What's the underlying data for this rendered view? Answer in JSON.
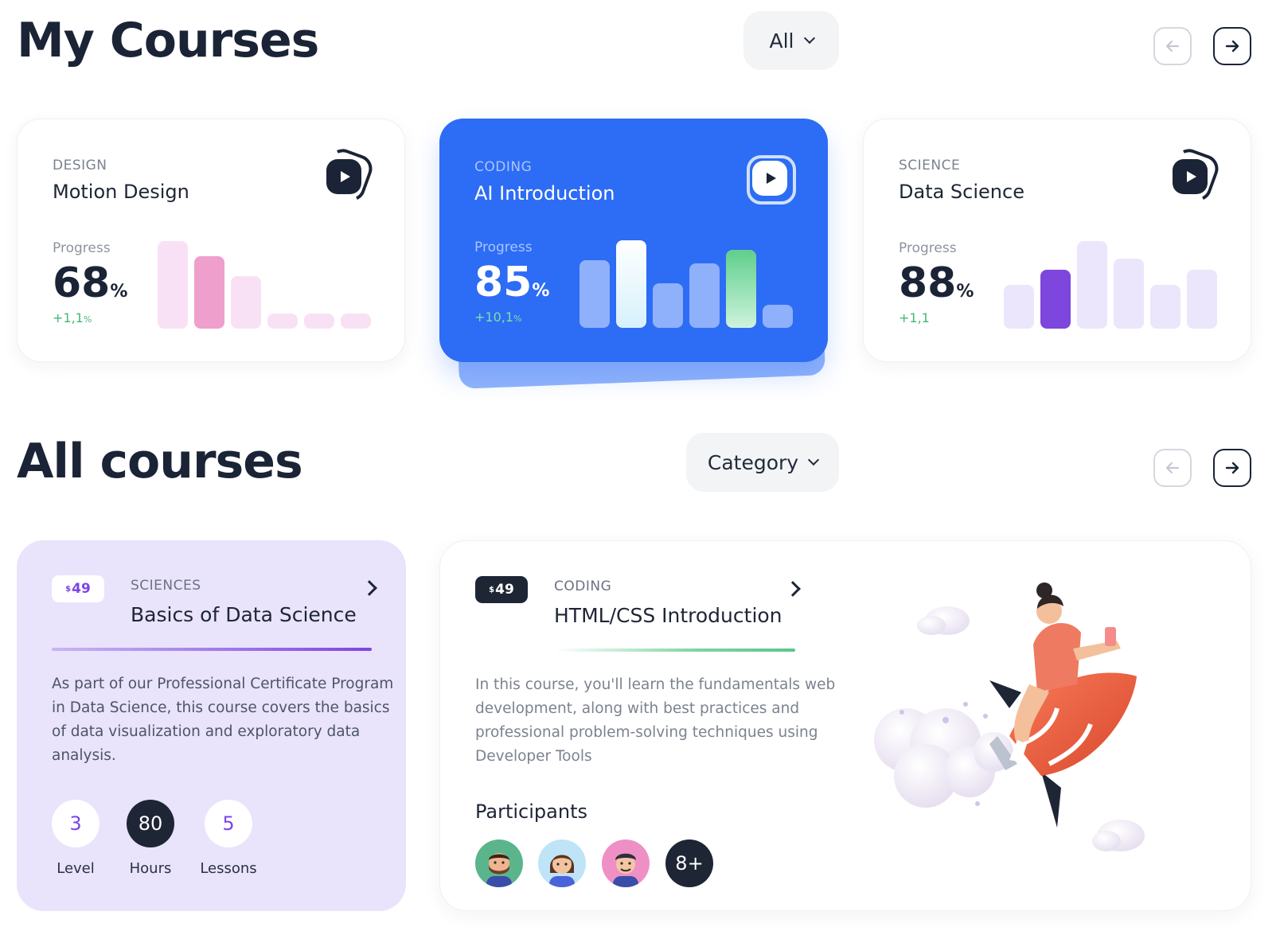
{
  "my_courses": {
    "title": "My Courses",
    "filter_label": "All",
    "cards": [
      {
        "category": "DESIGN",
        "title": "Motion Design",
        "progress_label": "Progress",
        "progress_value": "68",
        "percent_sign": "%",
        "delta": "+1,1",
        "delta_unit": "%",
        "bars": [
          {
            "height": 1.0,
            "color": "#f9e1f5"
          },
          {
            "height": 0.83,
            "color": "#ef9fcc"
          },
          {
            "height": 0.6,
            "color": "#f9e1f5"
          },
          {
            "height": 0.17,
            "color": "#f9e1f5"
          },
          {
            "height": 0.17,
            "color": "#f9e1f5"
          },
          {
            "height": 0.17,
            "color": "#f9e1f5"
          }
        ]
      },
      {
        "category": "CODING",
        "title": "AI Introduction",
        "progress_label": "Progress",
        "progress_value": "85",
        "percent_sign": "%",
        "delta": "+10,1",
        "delta_unit": "%",
        "bars": [
          {
            "height": 0.77,
            "color": "#8fb0fb"
          },
          {
            "height": 1.0,
            "color": "gradient-white"
          },
          {
            "height": 0.51,
            "color": "#8fb0fb"
          },
          {
            "height": 0.74,
            "color": "#8fb0fb"
          },
          {
            "height": 0.89,
            "color": "gradient-green"
          },
          {
            "height": 0.26,
            "color": "#8fb0fb"
          }
        ]
      },
      {
        "category": "SCIENCE",
        "title": "Data Science",
        "progress_label": "Progress",
        "progress_value": "88",
        "percent_sign": "%",
        "delta": "+1,1",
        "delta_unit": "",
        "bars": [
          {
            "height": 0.5,
            "color": "#ebe6fb"
          },
          {
            "height": 0.67,
            "color": "#7d46dc"
          },
          {
            "height": 1.0,
            "color": "#ebe6fb"
          },
          {
            "height": 0.8,
            "color": "#ebe6fb"
          },
          {
            "height": 0.5,
            "color": "#ebe6fb"
          },
          {
            "height": 0.67,
            "color": "#ebe6fb"
          }
        ]
      }
    ]
  },
  "all_courses": {
    "title": "All courses",
    "filter_label": "Category",
    "cards": [
      {
        "price_currency": "$",
        "price": "49",
        "category": "SCIENCES",
        "title": "Basics of Data Science",
        "description": [
          "As part of our Professional Certificate Program",
          "in Data Science, this course covers the basics",
          "of data visualization and exploratory data",
          "analysis."
        ],
        "stats": [
          {
            "value": "3",
            "label": "Level"
          },
          {
            "value": "80",
            "label": "Hours"
          },
          {
            "value": "5",
            "label": "Lessons"
          }
        ]
      },
      {
        "price_currency": "$",
        "price": "49",
        "category": "CODING",
        "title": "HTML/CSS Introduction",
        "description": [
          "In this course, you'll learn the fundamentals web",
          "development, along with best practices and",
          "professional problem-solving techniques using",
          "Developer Tools"
        ],
        "participants_title": "Participants",
        "more_participants": "8+"
      }
    ]
  },
  "colors": {
    "accent_blue": "#2d6cf4",
    "dark": "#1b2436",
    "purple": "#7d46dc",
    "green": "#43b87a"
  }
}
